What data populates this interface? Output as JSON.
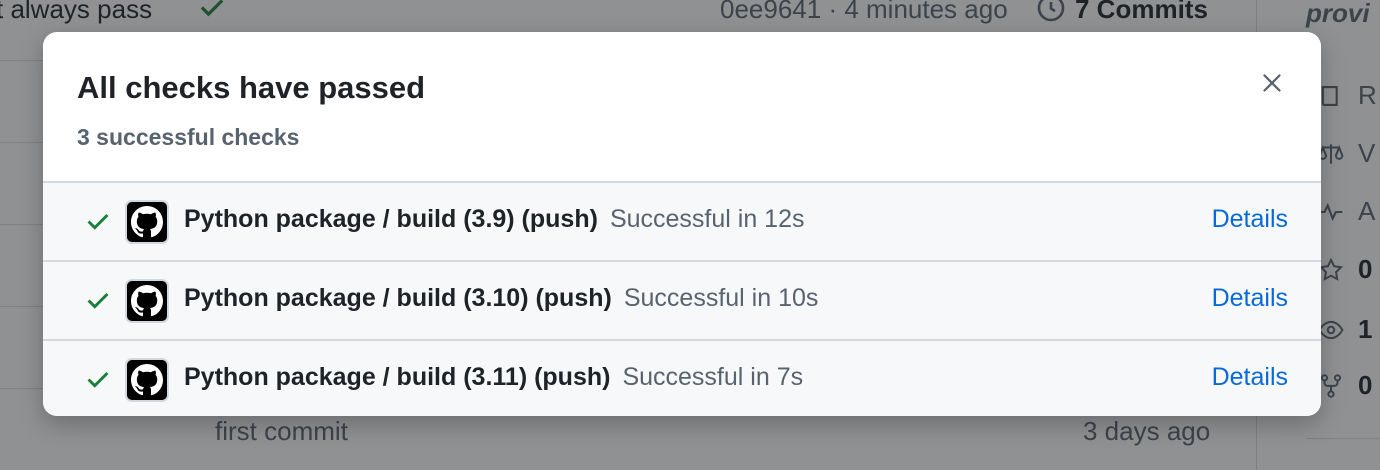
{
  "background": {
    "top_row": {
      "message": "t always pass",
      "commit_info": "0ee9641 · 4 minutes ago",
      "commits_label": "7 Commits",
      "sidebar_heading": "provi"
    },
    "bottom_row": {
      "message": "first commit",
      "time": "3 days ago"
    },
    "sidebar": [
      {
        "icon": "book-icon",
        "label": "R"
      },
      {
        "icon": "law-icon",
        "label": "V"
      },
      {
        "icon": "pulse-icon",
        "label": "A"
      },
      {
        "icon": "star-icon",
        "label": "0"
      },
      {
        "icon": "eye-icon",
        "label": "1"
      },
      {
        "icon": "fork-icon",
        "label": "0"
      }
    ]
  },
  "dialog": {
    "title": "All checks have passed",
    "subtitle": "3 successful checks",
    "close_icon": "x-icon",
    "checks": [
      {
        "name": "Python package / build (3.9) (push)",
        "status": "Successful in 12s",
        "details_label": "Details"
      },
      {
        "name": "Python package / build (3.10) (push)",
        "status": "Successful in 10s",
        "details_label": "Details"
      },
      {
        "name": "Python package / build (3.11) (push)",
        "status": "Successful in 7s",
        "details_label": "Details"
      }
    ]
  },
  "colors": {
    "success": "#1a7f37",
    "link": "#0969da",
    "overlay": "rgba(31,35,40,0.5)"
  }
}
